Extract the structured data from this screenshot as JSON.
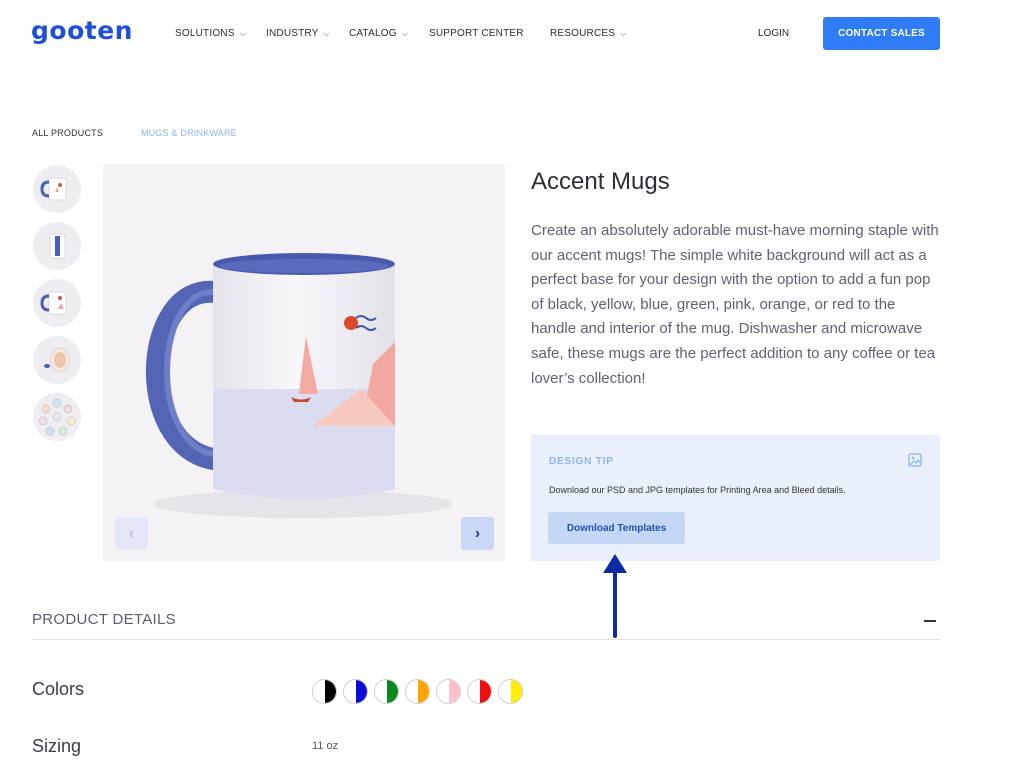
{
  "header": {
    "logo": "gooten",
    "nav": [
      {
        "label": "SOLUTIONS",
        "dropdown": true
      },
      {
        "label": "INDUSTRY",
        "dropdown": true
      },
      {
        "label": "CATALOG",
        "dropdown": true
      },
      {
        "label": "SUPPORT CENTER",
        "dropdown": false
      },
      {
        "label": "RESOURCES",
        "dropdown": true
      }
    ],
    "login": "LOGIN",
    "contact": "CONTACT SALES"
  },
  "breadcrumb": [
    "ALL PRODUCTS",
    "MUGS & DRINKWARE"
  ],
  "product": {
    "title": "Accent Mugs",
    "description": "Create an absolutely adorable must-have morning staple with our accent mugs! The simple white background will act as a perfect base for your design with the option to add a fun pop of black, yellow, blue, green, pink, orange, or red to the handle and interior of the mug. Dishwasher and microwave safe, these mugs are the perfect addition to any coffee or tea lover’s collection!"
  },
  "design_tip": {
    "label": "DESIGN TIP",
    "text": "Download our PSD and JPG templates for Printing Area and Bleed details.",
    "button": "Download Templates"
  },
  "gallery": {
    "prev_icon": "‹",
    "next_icon": "›",
    "thumbnail_count": 5
  },
  "details": {
    "title": "PRODUCT DETAILS",
    "colors_label": "Colors",
    "colors": [
      "#000000",
      "#0b0bd9",
      "#0a8a1e",
      "#ffa500",
      "#ffc0cb",
      "#ee1010",
      "#ffee00"
    ],
    "sizing_label": "Sizing",
    "sizing_value": "11 oz"
  },
  "colors": {
    "brand": "#1e4fd8",
    "accent_button": "#2f7cf6",
    "tip_bg": "#e9f0fc",
    "annotation_arrow": "#0b2aa6"
  }
}
